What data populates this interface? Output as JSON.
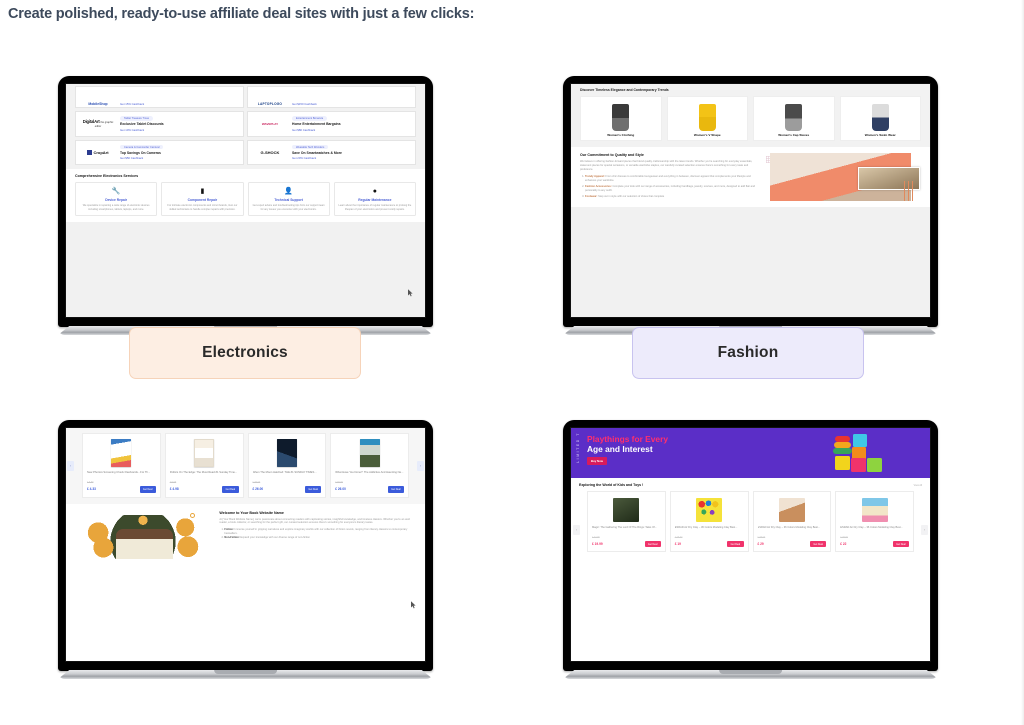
{
  "headline": "Create polished, ready-to-use affiliate deal sites with just a few clicks:",
  "categories": [
    {
      "label": "Electronics",
      "accent": "#fdeee3",
      "border": "#f6d3b9"
    },
    {
      "label": "Fashion",
      "accent": "#edebfb",
      "border": "#c8c3ef"
    }
  ],
  "sites": {
    "electronics": {
      "deals_partial": [
        {
          "brand": "MobileShop",
          "cashback": "Get 15% Cashback"
        },
        {
          "brand": "LAPTOPLOGO",
          "cashback": "Get $150 Cashback"
        }
      ],
      "deals": [
        {
          "brand": "DigitalArt",
          "brand_sub": "the graphic editor",
          "tag": "Tablet Treasure Trove",
          "title": "Exclusive Tablet Discounts",
          "cashback": "Get 10% Cashback"
        },
        {
          "brand": "WAVEPLAY",
          "brand_sub": "THE SOUND",
          "tag": "Entertainment Bonanza",
          "title": "Home Entertainment Bargains",
          "cashback": "Get $80 Cashback"
        },
        {
          "brand": "CropArt",
          "brand_sub": "photo & video",
          "tag": "Camera & Camcorder Carnival",
          "title": "Top Savings On Cameras",
          "cashback": "Get $50 Cashback"
        },
        {
          "brand": "G-SHOCK",
          "brand_sub": "",
          "tag": "Wearable Tech Wonders",
          "title": "Save On Smartwatches & More",
          "cashback": "Get 20% Cashback"
        }
      ],
      "services_heading": "Comprehensive Electronics Services",
      "services": [
        {
          "icon": "wrench-icon",
          "glyph": "🔧",
          "title": "Device Repair",
          "body": "We specialize in repairing a wide range of electronic devices including smartphones, tablets, laptops, and more."
        },
        {
          "icon": "chip-icon",
          "glyph": "▮",
          "title": "Component Repair",
          "body": "For intricate electronic components and circuit boards, trust our skilled technicians to handle complex repairs with precision."
        },
        {
          "icon": "support-agent-icon",
          "glyph": "👤",
          "title": "Technical Support",
          "body": "Get expert advice and troubleshooting tips from our support team for any issues you encounter with your electronics."
        },
        {
          "icon": "gear-icon",
          "glyph": "●",
          "title": "Regular Maintenance",
          "body": "Learn about the importance of regular maintenance to prolong the lifespan of your electronics and prevent costly repairs."
        }
      ]
    },
    "fashion": {
      "heading": "Discover Timeless Elegance and Contemporary Trends",
      "cards": [
        {
          "label": "Women's Clothing",
          "swatch": "s-black"
        },
        {
          "label": "Women's V Shape",
          "swatch": "s-yellow"
        },
        {
          "label": "Women's Cap Sleves",
          "swatch": "s-grey"
        },
        {
          "label": "Women's Swim Wear",
          "swatch": "s-swim"
        }
      ],
      "commitment_heading": "Our Commitment to Quality and Style",
      "commitment_body": "We believe in offering fashion-forward pieces that blend quality craftsmanship with the latest trends. Whether you're searching for everyday essentials, statement pieces for special occasions, or versatile wardrobe staples, our carefully curated selection ensures there's something for every taste and preference.",
      "commitment_list": [
        {
          "term": "Trendy Apparel:",
          "text": "From chic dresses to comfortable loungewear and everything in between, discover apparel that complements your lifestyle and enhances your wardrobe."
        },
        {
          "term": "Fashion Accessories:",
          "text": "Complete your look with our range of accessories, including handbags, jewelry, scarves, and more, designed to add flair and personality to any outfit."
        },
        {
          "term": "Footwear:",
          "text": "Step out in style with our selection of shoes that complete"
        }
      ]
    },
    "books": {
      "products": [
        {
          "title": "New Phonics Screening Check Flashcards - For Th...",
          "old_price": "£ 6.99",
          "price": "£ 4.33",
          "cta": "Get Deal"
        },
        {
          "title": "Politics On The Edge: The Must Read #1 Sunday Time...",
          "old_price": "£ 9.99",
          "price": "£ 4.98",
          "cta": "Get Deal"
        },
        {
          "title": "When The Moon Hatched: THE #1 SUNDAY TIMES...",
          "old_price": "£ 30.00",
          "price": "£ 26.00",
          "cta": "Get Deal"
        },
        {
          "title": "What Have You Done?: The Addictive And Haunting Ne...",
          "old_price": "£ 30.00",
          "price": "£ 26.00",
          "cta": "Get Deal"
        }
      ],
      "welcome_heading": "Welcome to Your Book Website Name",
      "welcome_body": "At [Your Book Website Name], we're passionate about connecting readers with captivating stories, insightful knowledge, and timeless classics. Whether you're an avid reader, a book collector, or searching for the perfect gift, our curated selection ensures there's something for everyone's literary tastes.",
      "welcome_list": [
        {
          "term": "Fiction:",
          "text": "Immerse yourself in gripping narratives and explore imaginary worlds with our collection of fiction novels, ranging from literary classics to contemporary bestsellers."
        },
        {
          "term": "Non-Fiction:",
          "text": "Expand your knowledge with our diverse range of non-fiction"
        }
      ]
    },
    "toys": {
      "hero_vertical": "LIMITED T",
      "hero_line1": "Playthings for Every",
      "hero_line2": "Age and Interest",
      "hero_cta": "Buy Now",
      "heading": "Exploring the World of Kids and Toys !",
      "view_all": "View All",
      "products": [
        {
          "title": "Magic: The Gathering The Lord Of The Rings: Tales Of...",
          "old_price": "£ 24.99",
          "price": "£ 19.99",
          "cta": "Get Deal",
          "thumb": "t1"
        },
        {
          "title": "ESRAD Air Dry Clay – 36 Colors Modeling Clay Best...",
          "old_price": "£ 25.00",
          "price": "£ 19",
          "cta": "Get Deal",
          "thumb": "t2"
        },
        {
          "title": "ESRAD Air Dry Clay – 36 Colors Modeling Clay Best...",
          "old_price": "£ 35.00",
          "price": "£ 29",
          "cta": "Get Deal",
          "thumb": "t3"
        },
        {
          "title": "ESRAD Air Dry Clay – 36 Colors Modeling Clay Best...",
          "old_price": "£ 28.00",
          "price": "£ 22",
          "cta": "Get Deal",
          "thumb": "t4"
        }
      ]
    }
  },
  "nav": {
    "prev": "‹",
    "next": "›"
  }
}
